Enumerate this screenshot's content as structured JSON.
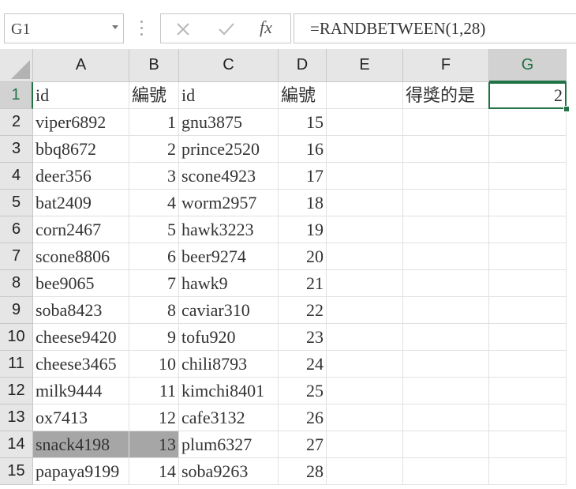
{
  "name_box": "G1",
  "formula": "=RANDBETWEEN(1,28)",
  "formula_buttons": {
    "cancel_icon": "✕",
    "enter_icon": "✓",
    "function_icon": "fx"
  },
  "columns": [
    "A",
    "B",
    "C",
    "D",
    "E",
    "F",
    "G"
  ],
  "selected_column": "G",
  "rows": [
    {
      "n": "1",
      "A": "id",
      "B": "編號",
      "C": "id",
      "D": "編號",
      "E": "",
      "F": "得獎的是",
      "G": "2"
    },
    {
      "n": "2",
      "A": "viper6892",
      "B": "1",
      "C": "gnu3875",
      "D": "15",
      "E": "",
      "F": "",
      "G": ""
    },
    {
      "n": "3",
      "A": "bbq8672",
      "B": "2",
      "C": "prince2520",
      "D": "16",
      "E": "",
      "F": "",
      "G": ""
    },
    {
      "n": "4",
      "A": "deer356",
      "B": "3",
      "C": "scone4923",
      "D": "17",
      "E": "",
      "F": "",
      "G": ""
    },
    {
      "n": "5",
      "A": "bat2409",
      "B": "4",
      "C": "worm2957",
      "D": "18",
      "E": "",
      "F": "",
      "G": ""
    },
    {
      "n": "6",
      "A": "corn2467",
      "B": "5",
      "C": "hawk3223",
      "D": "19",
      "E": "",
      "F": "",
      "G": ""
    },
    {
      "n": "7",
      "A": "scone8806",
      "B": "6",
      "C": "beer9274",
      "D": "20",
      "E": "",
      "F": "",
      "G": ""
    },
    {
      "n": "8",
      "A": "bee9065",
      "B": "7",
      "C": "hawk9",
      "D": "21",
      "E": "",
      "F": "",
      "G": ""
    },
    {
      "n": "9",
      "A": "soba8423",
      "B": "8",
      "C": "caviar310",
      "D": "22",
      "E": "",
      "F": "",
      "G": ""
    },
    {
      "n": "10",
      "A": "cheese9420",
      "B": "9",
      "C": "tofu920",
      "D": "23",
      "E": "",
      "F": "",
      "G": ""
    },
    {
      "n": "11",
      "A": "cheese3465",
      "B": "10",
      "C": "chili8793",
      "D": "24",
      "E": "",
      "F": "",
      "G": ""
    },
    {
      "n": "12",
      "A": "milk9444",
      "B": "11",
      "C": "kimchi8401",
      "D": "25",
      "E": "",
      "F": "",
      "G": ""
    },
    {
      "n": "13",
      "A": "ox7413",
      "B": "12",
      "C": "cafe3132",
      "D": "26",
      "E": "",
      "F": "",
      "G": ""
    },
    {
      "n": "14",
      "A": "snack4198",
      "B": "13",
      "C": "plum6327",
      "D": "27",
      "E": "",
      "F": "",
      "G": ""
    },
    {
      "n": "15",
      "A": "papaya9199",
      "B": "14",
      "C": "soba9263",
      "D": "28",
      "E": "",
      "F": "",
      "G": ""
    }
  ],
  "highlighted_row": "14",
  "colors": {
    "accent": "#217346",
    "highlight": "#a6a6a6",
    "header": "#e6e6e6"
  }
}
